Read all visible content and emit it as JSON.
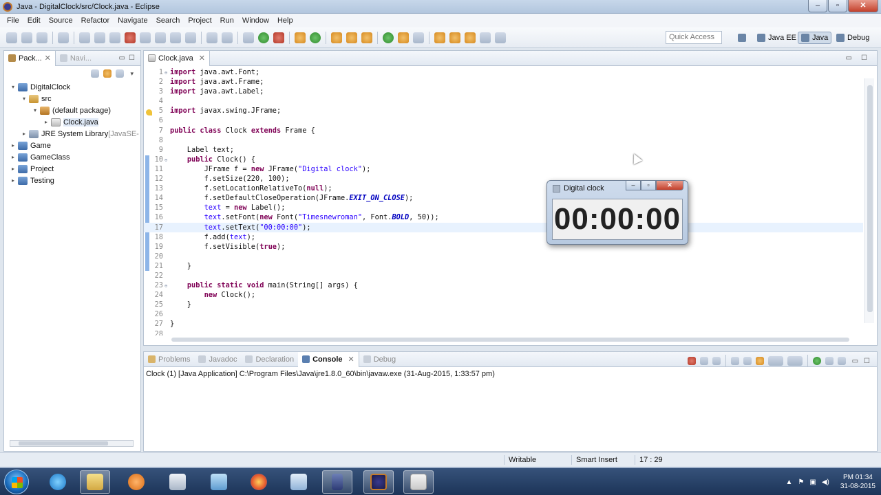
{
  "window": {
    "title": "Java - DigitalClock/src/Clock.java - Eclipse"
  },
  "menu": [
    "File",
    "Edit",
    "Source",
    "Refactor",
    "Navigate",
    "Search",
    "Project",
    "Run",
    "Window",
    "Help"
  ],
  "toolbar": {
    "quick_access": "Quick Access",
    "perspectives": [
      "Java EE",
      "Java",
      "Debug"
    ]
  },
  "left_panel": {
    "tabs": [
      "Pack...",
      "Navi..."
    ],
    "tree": [
      {
        "label": "DigitalClock",
        "decoration": "",
        "indent": 0,
        "arrow": "▾",
        "icon": "proj"
      },
      {
        "label": "src",
        "decoration": "",
        "indent": 1,
        "arrow": "▾",
        "icon": "srcf"
      },
      {
        "label": "(default package)",
        "decoration": "",
        "indent": 2,
        "arrow": "▾",
        "icon": "pkg"
      },
      {
        "label": "Clock.java",
        "decoration": "",
        "indent": 3,
        "arrow": "▸",
        "icon": "jfile"
      },
      {
        "label": "JRE System Library",
        "decoration": "[JavaSE-",
        "indent": 1,
        "arrow": "▸",
        "icon": "lib"
      },
      {
        "label": "Game",
        "decoration": "",
        "indent": 0,
        "arrow": "▸",
        "icon": "proj"
      },
      {
        "label": "GameClass",
        "decoration": "",
        "indent": 0,
        "arrow": "▸",
        "icon": "proj"
      },
      {
        "label": "Project",
        "decoration": "",
        "indent": 0,
        "arrow": "▸",
        "icon": "proj"
      },
      {
        "label": "Testing",
        "decoration": "",
        "indent": 0,
        "arrow": "▸",
        "icon": "proj"
      }
    ]
  },
  "editor": {
    "tab": "Clock.java",
    "current_line": 17,
    "lines": [
      {
        "n": "1",
        "fold": "⊖",
        "html": "<span class=\"kw\">import</span> java.awt.Font;"
      },
      {
        "n": "2",
        "fold": "",
        "html": "<span class=\"kw\">import</span> java.awt.Frame;"
      },
      {
        "n": "3",
        "fold": "",
        "html": "<span class=\"kw\">import</span> java.awt.Label;"
      },
      {
        "n": "4",
        "fold": "",
        "html": ""
      },
      {
        "n": "5",
        "fold": "",
        "html": "<span class=\"kw\">import</span> javax.swing.JFrame;"
      },
      {
        "n": "6",
        "fold": "",
        "html": ""
      },
      {
        "n": "7",
        "fold": "",
        "html": "<span class=\"kw\">public</span> <span class=\"kw\">class</span> Clock <span class=\"kw\">extends</span> Frame {"
      },
      {
        "n": "8",
        "fold": "",
        "html": ""
      },
      {
        "n": "9",
        "fold": "",
        "html": "    Label text;"
      },
      {
        "n": "10",
        "fold": "⊖",
        "html": "    <span class=\"kw\">public</span> Clock() {"
      },
      {
        "n": "11",
        "fold": "",
        "html": "        JFrame f = <span class=\"kw\">new</span> JFrame(<span class=\"str\">\"Digital clock\"</span>);"
      },
      {
        "n": "12",
        "fold": "",
        "html": "        f.setSize(220, 100);"
      },
      {
        "n": "13",
        "fold": "",
        "html": "        f.setLocationRelativeTo(<span class=\"kw\">null</span>);"
      },
      {
        "n": "14",
        "fold": "",
        "html": "        f.setDefaultCloseOperation(JFrame.<span class=\"it\">EXIT_ON_CLOSE</span>);"
      },
      {
        "n": "15",
        "fold": "",
        "html": "        <span class=\"str\">text</span> = <span class=\"kw\">new</span> Label();"
      },
      {
        "n": "16",
        "fold": "",
        "html": "        <span class=\"str\">text</span>.setFont(<span class=\"kw\">new</span> Font(<span class=\"str\">\"Timesnewroman\"</span>, Font.<span class=\"it\">BOLD</span>, 50));"
      },
      {
        "n": "17",
        "fold": "",
        "html": "        <span class=\"str\">text</span>.setText(<span class=\"str\">\"00:00:00\"</span>);"
      },
      {
        "n": "18",
        "fold": "",
        "html": "        f.add(<span class=\"str\">text</span>);"
      },
      {
        "n": "19",
        "fold": "",
        "html": "        f.setVisible(<span class=\"kw\">true</span>);"
      },
      {
        "n": "20",
        "fold": "",
        "html": ""
      },
      {
        "n": "21",
        "fold": "",
        "html": "    }"
      },
      {
        "n": "22",
        "fold": "",
        "html": ""
      },
      {
        "n": "23",
        "fold": "⊖",
        "html": "    <span class=\"kw\">public</span> <span class=\"kw\">static</span> <span class=\"kw\">void</span> main(String[] args) {"
      },
      {
        "n": "24",
        "fold": "",
        "html": "        <span class=\"kw\">new</span> Clock();"
      },
      {
        "n": "25",
        "fold": "",
        "html": "    }"
      },
      {
        "n": "26",
        "fold": "",
        "html": ""
      },
      {
        "n": "27",
        "fold": "",
        "html": "}"
      },
      {
        "n": "28",
        "fold": "",
        "html": ""
      }
    ]
  },
  "console": {
    "tabs": [
      "Problems",
      "Javadoc",
      "Declaration",
      "Console",
      "Debug"
    ],
    "active_tab": "Console",
    "description": "Clock (1) [Java Application] C:\\Program Files\\Java\\jre1.8.0_60\\bin\\javaw.exe (31-Aug-2015, 1:33:57 pm)"
  },
  "status": {
    "mode": "Writable",
    "insert": "Smart Insert",
    "position": "17 : 29"
  },
  "clock_window": {
    "title": "Digital clock",
    "time": "00:00:00"
  },
  "taskbar": {
    "time": "PM 01:34",
    "date": "31-08-2015"
  }
}
